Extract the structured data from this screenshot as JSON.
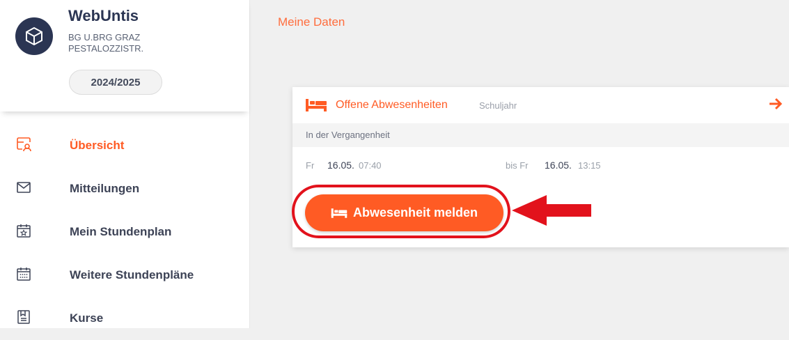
{
  "sidebar": {
    "app_name": "WebUntis",
    "school_line1": "BG U.BRG GRAZ",
    "school_line2": "PESTALOZZISTR.",
    "school_year": "2024/2025",
    "items": [
      {
        "label": "Übersicht",
        "icon": "dashboard-icon",
        "active": true
      },
      {
        "label": "Mitteilungen",
        "icon": "envelope-icon",
        "active": false
      },
      {
        "label": "Mein Stundenplan",
        "icon": "calendar-star-icon",
        "active": false
      },
      {
        "label": "Weitere Stundenpläne",
        "icon": "calendar-grid-icon",
        "active": false
      },
      {
        "label": "Kurse",
        "icon": "book-icon",
        "active": false
      }
    ]
  },
  "main": {
    "title": "Meine Daten",
    "card": {
      "title": "Offene Abwesenheiten",
      "subtitle": "Schuljahr",
      "section_label": "In der Vergangenheit",
      "absence": {
        "from_day": "Fr",
        "from_date": "16.05.",
        "from_time": "07:40",
        "to_prefix": "bis Fr",
        "to_date": "16.05.",
        "to_time": "13:15"
      },
      "button_label": "Abwesenheit melden"
    }
  },
  "colors": {
    "accent": "#ff5b24",
    "annotation": "#e2121c",
    "brand_dark": "#2b3553"
  }
}
